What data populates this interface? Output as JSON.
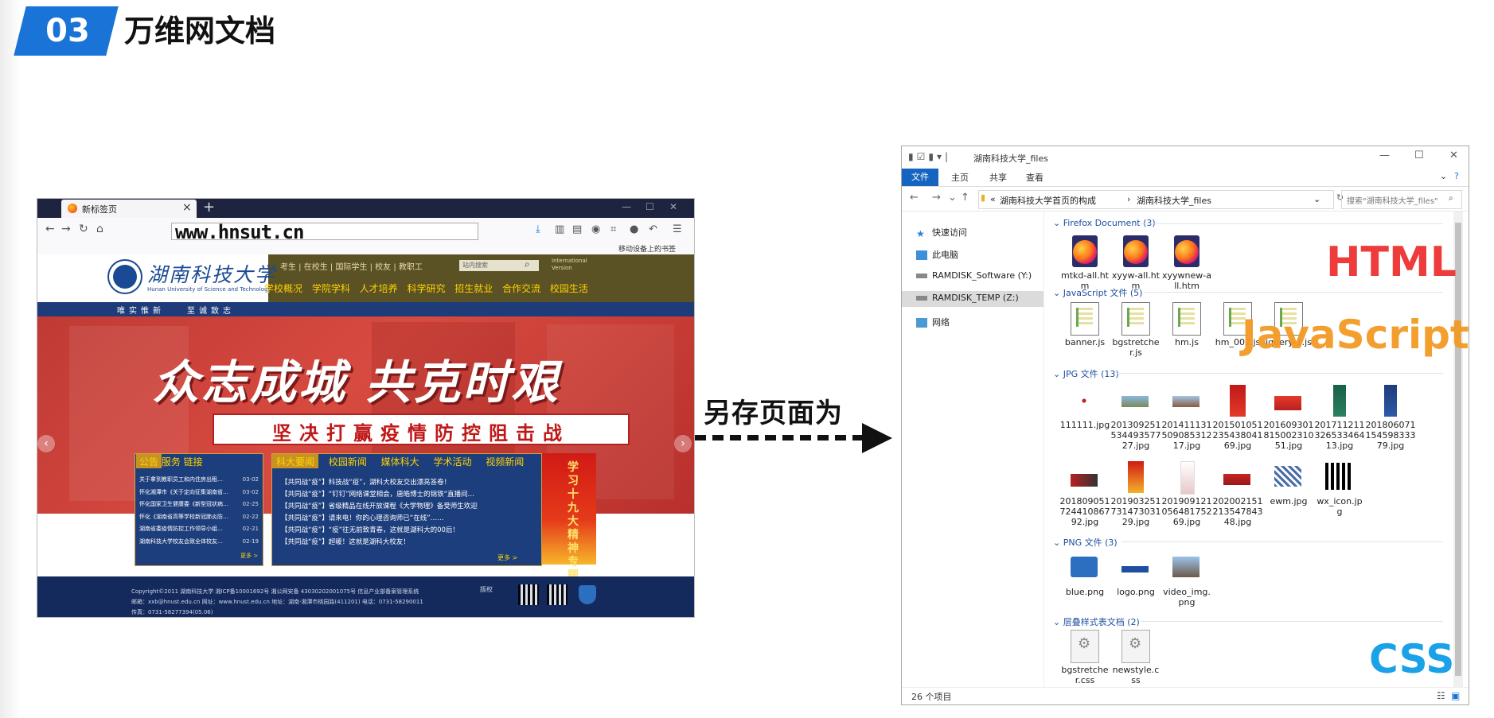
{
  "slide": {
    "number": "03",
    "title": "万维网文档",
    "arrow_label": "另存页面为"
  },
  "browser": {
    "tab_title": "新标签页",
    "url": "www.hnsut.cn",
    "bookmark_hint": "移动设备上的书签",
    "site": {
      "top_links": "考生 | 在校生 | 国际学生 | 校友 | 教职工",
      "search_placeholder": "站内搜索",
      "intl_line1": "International",
      "intl_line2": "Version",
      "nav": "学校概况 学院学科 人才培养 科学研究 招生就业 合作交流 校园生活",
      "motto1": "唯实惟新",
      "motto2": "至诚致志",
      "slogan": "众志成城 共克时艰",
      "slogan_sub": "坚决打赢疫情防控阻击战",
      "news1_tabs": "公告  服务  链接",
      "news1_items": [
        {
          "t": "关于拿到教职员工和内住房出租…",
          "d": "03-02"
        },
        {
          "t": "怀化湘潭市《关于定向征集湖南省…",
          "d": "03-02"
        },
        {
          "t": "怀化国家卫生健康委《新型冠状病…",
          "d": "02-25"
        },
        {
          "t": "怀化《湖南省高等学校新冠肺炎防…",
          "d": "02-22"
        },
        {
          "t": "湖南省委疫情防控工作领导小组…",
          "d": "02-21"
        },
        {
          "t": "湖南科技大学校友会致全体校友…",
          "d": "02-19"
        }
      ],
      "news1_more": "更多 >",
      "news2_tabs": "科大要闻 校园新闻 媒体科大 学术活动 视频新闻",
      "news2_items": [
        "【共同战“疫”】科技战“疫”，湖科大校友交出漂亮答卷！",
        "【共同战“疫”】“钉钉”网络课堂相会，唐皓博士的锦铁“直播间…",
        "【共同战“疫”】省级精品在线开放课程《大学物理》备受师生欢迎",
        "【共同战“疫”】请来电！你的心理咨询师已“在线”……",
        "【共同战“疫”】“疫”往无前致青春，这就是湖科大的00后！",
        "【共同战“疫”】超暖！这就是湖科大校友！"
      ],
      "news2_more": "更多 >",
      "special_text": "学习十九大精神专题",
      "footer_line1": "Copyright©2011 湖南科技大学 湘ICP备10001692号 湘公网安备 43030202001075号 信息产业部备案管理系统",
      "footer_line2": "邮箱：xxb@hnust.edu.cn 网址：www.hnust.edu.cn 地址：湖南·湘潭市桃园路(411201) 电话：0731-58290011",
      "footer_line3": "传真：0731-58277394(05.06)",
      "footer_link": "版权"
    }
  },
  "explorer": {
    "title": "湖南科技大学_files",
    "ribbon_tabs": [
      "文件",
      "主页",
      "共享",
      "查看"
    ],
    "address_parent": "湖南科技大学首页的构成",
    "address_current": "湖南科技大学_files",
    "search_placeholder": "搜索\"湖南科技大学_files\"",
    "nav": [
      "快速访问",
      "此电脑",
      "RAMDISK_Software (Y:)",
      "RAMDISK_TEMP (Z:)",
      "网络"
    ],
    "groups": [
      {
        "header": "Firefox Document (3)",
        "files": [
          "mtkd-all.htm",
          "xyyw-all.htm",
          "xyywnew-all.htm"
        ]
      },
      {
        "header": "JavaScript 文件 (5)",
        "files": [
          "banner.js",
          "bgstretcher.js",
          "hm.js",
          "hm_002.js",
          "jquery-1.js"
        ]
      },
      {
        "header": "JPG 文件 (13)",
        "files": [
          "111111.jpg",
          "20130925153449357727.jpg",
          "20141113150908531217.jpg",
          "20150105123543804169.jpg",
          "20160930181500231051.jpg",
          "20171121132653346413.jpg",
          "20180607115459833379.jpg",
          "20180905172441086792.jpg",
          "20190325173147303129.jpg",
          "20190912105648175269.jpg",
          "20200215121354784348.jpg",
          "ewm.jpg",
          "wx_icon.jpg"
        ]
      },
      {
        "header": "PNG 文件 (3)",
        "files": [
          "blue.png",
          "logo.png",
          "video_img.png"
        ]
      },
      {
        "header": "层叠样式表文档 (2)",
        "files": [
          "bgstretcher.css",
          "newstyle.css"
        ]
      }
    ],
    "status": "26 个项目"
  },
  "labels": {
    "html": "HTML",
    "js": "JavaScript",
    "css": "CSS"
  }
}
